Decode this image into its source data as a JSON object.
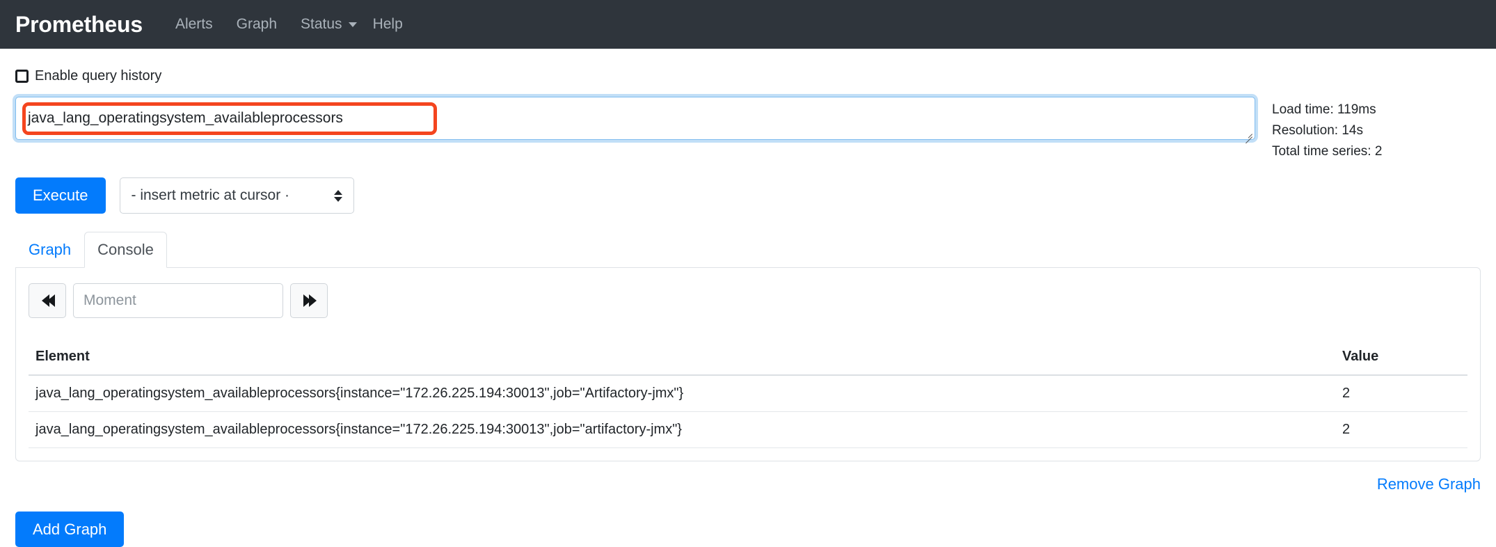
{
  "navbar": {
    "brand": "Prometheus",
    "links": [
      {
        "label": "Alerts",
        "icon": ""
      },
      {
        "label": "Graph",
        "icon": ""
      },
      {
        "label": "Status",
        "icon": "chevron-down-icon"
      },
      {
        "label": "Help",
        "icon": ""
      }
    ],
    "background": "#2f353c",
    "link_color": "#aab2ba"
  },
  "query_history": {
    "label": "Enable query history",
    "checked": false
  },
  "query": {
    "value": "java_lang_operatingsystem_availableprocessors",
    "placeholder": "Expression (press Shift+Enter for newlines)",
    "focus_color": "#80bdef",
    "annotation_color": "#f4451f"
  },
  "stats": {
    "load_time": "Load time: 119ms",
    "resolution": "Resolution: 14s",
    "total_time_series": "Total time series: 2"
  },
  "controls": {
    "execute_label": "Execute",
    "metric_select_value": "- insert metric at cursor ·",
    "accent": "#037bfc"
  },
  "tabs": [
    {
      "label": "Graph",
      "active": false
    },
    {
      "label": "Console",
      "active": true
    }
  ],
  "moment": {
    "prev_icon": "rewind-icon",
    "next_icon": "fast-forward-icon",
    "placeholder": "Moment",
    "value": ""
  },
  "table": {
    "columns": [
      "Element",
      "Value"
    ],
    "rows": [
      {
        "element": "java_lang_operatingsystem_availableprocessors{instance=\"172.26.225.194:30013\",job=\"Artifactory-jmx\"}",
        "value": "2"
      },
      {
        "element": "java_lang_operatingsystem_availableprocessors{instance=\"172.26.225.194:30013\",job=\"artifactory-jmx\"}",
        "value": "2"
      }
    ]
  },
  "footer": {
    "remove_graph": "Remove Graph",
    "add_graph": "Add Graph"
  }
}
